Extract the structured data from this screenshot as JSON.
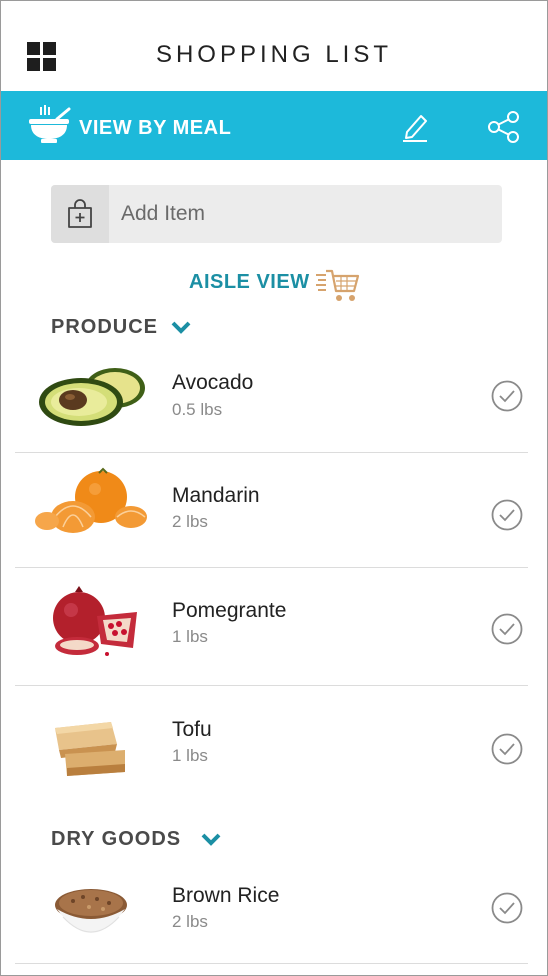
{
  "header": {
    "title": "SHOPPING LIST",
    "menu_icon": "grid-icon"
  },
  "toolbar": {
    "view_label": "VIEW BY MEAL",
    "bowl_icon": "bowl-icon",
    "edit_icon": "pencil-icon",
    "share_icon": "share-icon",
    "accent_color": "#1db9da"
  },
  "add_item": {
    "placeholder": "Add Item",
    "icon": "shopping-bag-plus-icon"
  },
  "aisle_view": {
    "label": "AISLE VIEW",
    "icon": "shopping-cart-icon",
    "color": "#1b8fa4"
  },
  "sections": [
    {
      "title": "PRODUCE",
      "items": [
        {
          "name": "Avocado",
          "qty": "0.5 lbs",
          "image": "avocado"
        },
        {
          "name": "Mandarin",
          "qty": "2 lbs",
          "image": "mandarin"
        },
        {
          "name": "Pomegrante",
          "qty": "1 lbs",
          "image": "pomegranate"
        },
        {
          "name": "Tofu",
          "qty": "1 lbs",
          "image": "tofu"
        }
      ]
    },
    {
      "title": "DRY GOODS",
      "items": [
        {
          "name": "Brown Rice",
          "qty": "2 lbs",
          "image": "brown-rice"
        }
      ]
    }
  ]
}
